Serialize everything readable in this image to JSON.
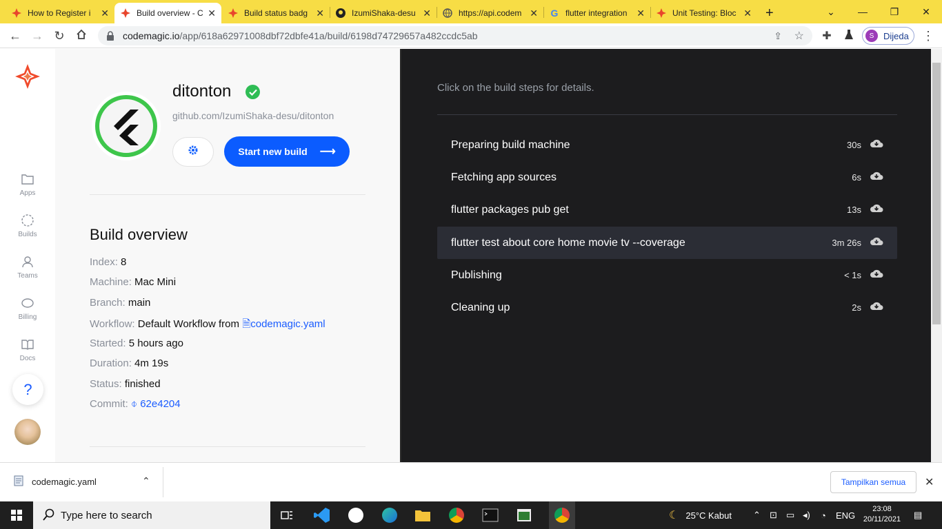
{
  "browser": {
    "tabs": [
      {
        "title": "How to Register i",
        "favicon": "codemagic-icon"
      },
      {
        "title": "Build overview - C",
        "favicon": "codemagic-icon",
        "active": true
      },
      {
        "title": "Build status badg",
        "favicon": "codemagic-icon"
      },
      {
        "title": "IzumiShaka-desu",
        "favicon": "github-icon"
      },
      {
        "title": "https://api.codem",
        "favicon": "globe-icon"
      },
      {
        "title": "flutter integration",
        "favicon": "google-icon"
      },
      {
        "title": "Unit Testing: Bloc",
        "favicon": "codemagic-icon"
      }
    ],
    "url_host": "codemagic.io",
    "url_path": "/app/618a62971008dbf72dbfe41a/build/6198d74729657a482ccdc5ab",
    "profile_initial": "S",
    "profile_name": "Dijeda"
  },
  "sidebar": {
    "items": [
      {
        "label": "Apps",
        "icon": "folder-icon"
      },
      {
        "label": "Builds",
        "icon": "builds-icon"
      },
      {
        "label": "Teams",
        "icon": "user-icon"
      },
      {
        "label": "Billing",
        "icon": "piggy-bank-icon"
      },
      {
        "label": "Docs",
        "icon": "book-icon"
      }
    ],
    "help": "?"
  },
  "app": {
    "name": "ditonton",
    "repo": "github.com/IzumiShaka-desu/ditonton",
    "start_build_label": "Start new build"
  },
  "overview": {
    "title": "Build overview",
    "index_label": "Index:",
    "index": "8",
    "machine_label": "Machine:",
    "machine": "Mac Mini",
    "branch_label": "Branch:",
    "branch": "main",
    "workflow_label": "Workflow:",
    "workflow": "Default Workflow from",
    "workflow_file": "codemagic.yaml",
    "started_label": "Started:",
    "started": "5 hours ago",
    "duration_label": "Duration:",
    "duration": "4m 19s",
    "status_label": "Status:",
    "status": "finished",
    "commit_label": "Commit:",
    "commit": "62e4204"
  },
  "steps_panel": {
    "hint": "Click on the build steps for details.",
    "steps": [
      {
        "name": "Preparing build machine",
        "duration": "30s"
      },
      {
        "name": "Fetching app sources",
        "duration": "6s"
      },
      {
        "name": "flutter packages pub get",
        "duration": "13s"
      },
      {
        "name": "flutter test about core home movie tv --coverage",
        "duration": "3m 26s",
        "selected": true
      },
      {
        "name": "Publishing",
        "duration": "< 1s"
      },
      {
        "name": "Cleaning up",
        "duration": "2s"
      }
    ]
  },
  "downloads": {
    "file": "codemagic.yaml",
    "show_all": "Tampilkan semua"
  },
  "taskbar": {
    "search_placeholder": "Type here to search",
    "weather": "25°C  Kabut",
    "lang": "ENG",
    "time": "23:08",
    "date": "20/11/2021"
  },
  "colors": {
    "accent": "#0b5cff",
    "tabbar": "#f7dd45",
    "success": "#2fbd55",
    "panel": "#1c1c1e"
  }
}
